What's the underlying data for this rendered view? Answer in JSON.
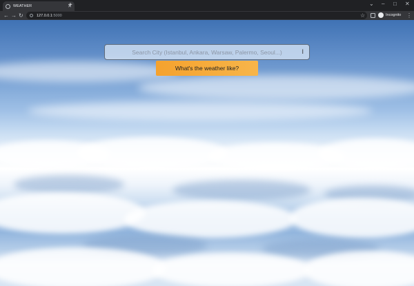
{
  "browser": {
    "tab_title": "WEATHER",
    "url_host": "127.0.0.1",
    "url_port": ":5000",
    "profile_label": "Incognito"
  },
  "page": {
    "search_placeholder": "Search City (Istanbul, Ankara, Warsaw, Palermo, Seoul...)",
    "search_value": "",
    "button_label": "What's the weather like?"
  },
  "colors": {
    "button": "#f5a22e",
    "sky_top": "#3f72b4"
  }
}
